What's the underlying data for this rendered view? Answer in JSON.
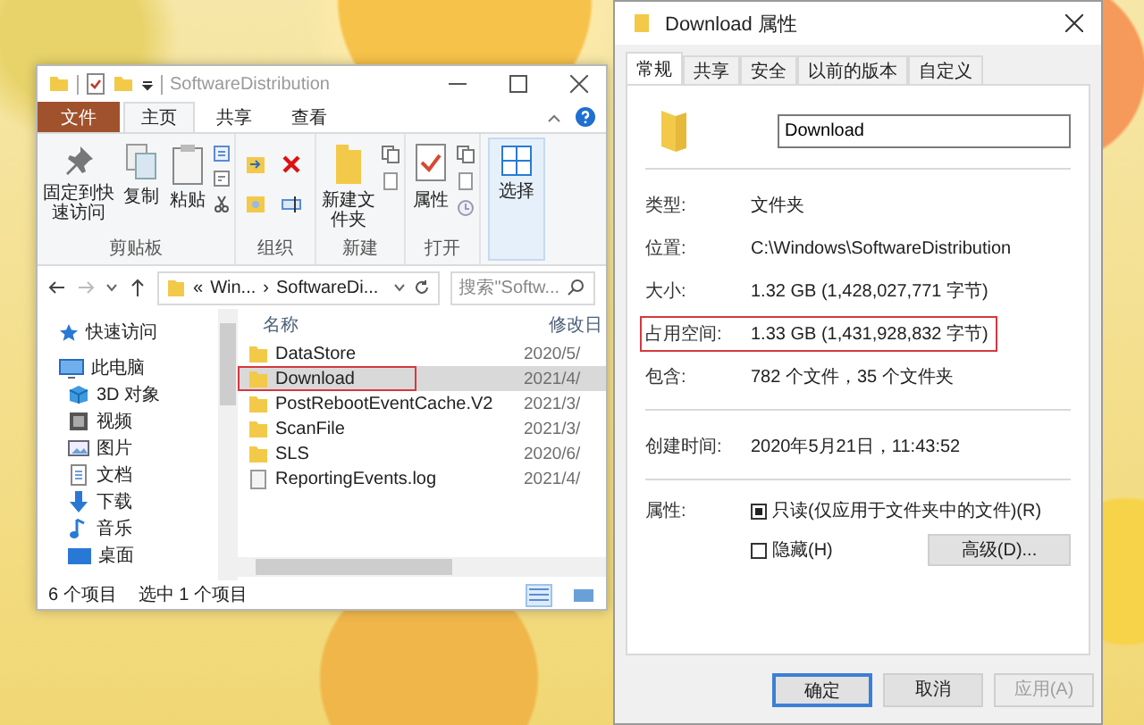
{
  "explorer": {
    "title": "SoftwareDistribution",
    "ribbon_tabs": [
      {
        "label": "文件",
        "kind": "file",
        "selected": false
      },
      {
        "label": "主页",
        "kind": "tab",
        "selected": true
      },
      {
        "label": "共享",
        "kind": "tab",
        "selected": false
      },
      {
        "label": "查看",
        "kind": "tab",
        "selected": false
      }
    ],
    "ribbon_groups": [
      {
        "label": "剪贴板",
        "kind": "clipboard",
        "buttons": [
          {
            "label": "固定到快速访问",
            "kind": "pin"
          },
          {
            "label": "复制",
            "kind": "copy"
          },
          {
            "label": "粘贴",
            "kind": "paste"
          }
        ]
      },
      {
        "label": "组织",
        "kind": "organize"
      },
      {
        "label": "新建",
        "kind": "new",
        "buttons": [
          {
            "label": "新建文件夹",
            "kind": "folder"
          }
        ]
      },
      {
        "label": "打开",
        "kind": "open",
        "buttons": [
          {
            "label": "属性",
            "kind": "properties"
          }
        ]
      },
      {
        "kind": "select",
        "buttons": [
          {
            "label": "选择",
            "kind": "select"
          }
        ]
      }
    ],
    "address": {
      "overflow": "«",
      "separator": "›",
      "segments": [
        "Win...",
        "SoftwareDi..."
      ]
    },
    "search": {
      "placeholder": "搜索\"Softw..."
    },
    "nav": [
      {
        "label": "快速访问",
        "kind": "star"
      },
      {
        "label": "此电脑",
        "kind": "pc",
        "children": [
          {
            "label": "3D 对象",
            "kind": "cube"
          },
          {
            "label": "视频",
            "kind": "video"
          },
          {
            "label": "图片",
            "kind": "picture"
          },
          {
            "label": "文档",
            "kind": "document"
          },
          {
            "label": "下载",
            "kind": "download"
          },
          {
            "label": "音乐",
            "kind": "music"
          },
          {
            "label": "桌面",
            "kind": "desktop"
          }
        ]
      }
    ],
    "columns": [
      "名称",
      "修改日"
    ],
    "files": [
      {
        "name": "DataStore",
        "date": "2020/5/",
        "kind": "folder",
        "selected": false,
        "highlighted": false
      },
      {
        "name": "Download",
        "date": "2021/4/",
        "kind": "folder",
        "selected": true,
        "highlighted": true
      },
      {
        "name": "PostRebootEventCache.V2",
        "date": "2021/3/",
        "kind": "folder",
        "selected": false,
        "highlighted": false
      },
      {
        "name": "ScanFile",
        "date": "2021/3/",
        "kind": "folder",
        "selected": false,
        "highlighted": false
      },
      {
        "name": "SLS",
        "date": "2020/6/",
        "kind": "folder",
        "selected": false,
        "highlighted": false
      },
      {
        "name": "ReportingEvents.log",
        "date": "2021/4/",
        "kind": "file",
        "selected": false,
        "highlighted": false
      }
    ],
    "status": [
      "6 个项目",
      "选中 1 个项目"
    ]
  },
  "properties": {
    "title": "Download 属性",
    "tabs": [
      {
        "label": "常规",
        "selected": true
      },
      {
        "label": "共享",
        "selected": false
      },
      {
        "label": "安全",
        "selected": false
      },
      {
        "label": "以前的版本",
        "selected": false
      },
      {
        "label": "自定义",
        "selected": false
      }
    ],
    "name_value": "Download",
    "sections": [
      [
        {
          "label": "类型:",
          "value": "文件夹",
          "highlighted": false
        },
        {
          "label": "位置:",
          "value": "C:\\Windows\\SoftwareDistribution",
          "highlighted": false
        },
        {
          "label": "大小:",
          "value": "1.32 GB (1,428,027,771 字节)",
          "highlighted": false
        },
        {
          "label": "占用空间:",
          "value": "1.33 GB (1,431,928,832 字节)",
          "highlighted": true
        },
        {
          "label": "包含:",
          "value": "782 个文件，35 个文件夹",
          "highlighted": false
        }
      ],
      [
        {
          "label": "创建时间:",
          "value": "2020年5月21日，11:43:52",
          "highlighted": false
        }
      ]
    ],
    "attributes_label": "属性:",
    "attributes": [
      {
        "label": "只读(仅应用于文件夹中的文件)(R)",
        "checked": true
      },
      {
        "label": "隐藏(H)",
        "checked": false
      }
    ],
    "advanced_button": "高级(D)...",
    "buttons": [
      {
        "label": "确定",
        "default": true,
        "disabled": false
      },
      {
        "label": "取消",
        "default": false,
        "disabled": false
      },
      {
        "label": "应用(A)",
        "default": false,
        "disabled": true
      }
    ]
  }
}
